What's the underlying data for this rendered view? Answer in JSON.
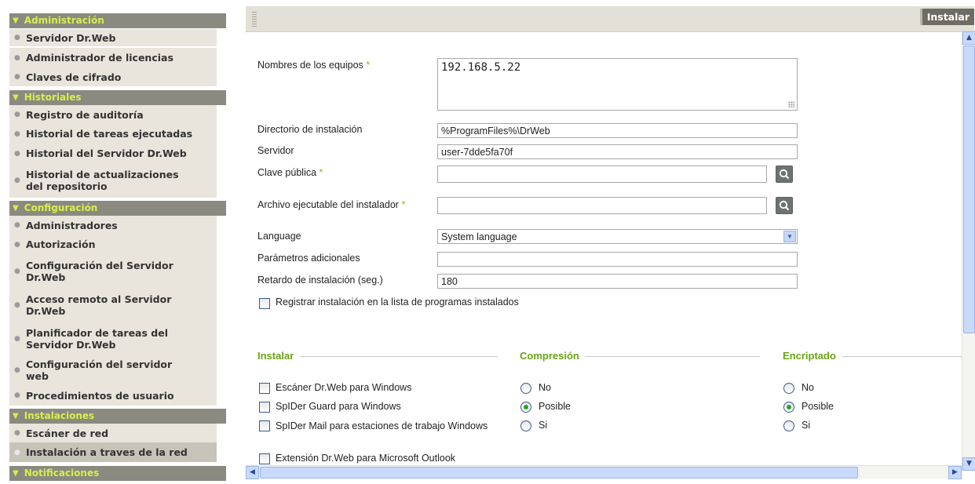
{
  "sidebar": {
    "sections": [
      {
        "title": "Administración",
        "items": [
          "Servidor Dr.Web",
          "Administrador de licencias",
          "Claves de cifrado"
        ]
      },
      {
        "title": "Historiales",
        "items": [
          "Registro de auditoría",
          "Historial de tareas ejecutadas",
          "Historial del Servidor Dr.Web",
          "Historial de actualizaciones del repositorio"
        ]
      },
      {
        "title": "Configuración",
        "items": [
          "Administradores",
          "Autorización",
          "Configuración del Servidor Dr.Web",
          "Acceso remoto al Servidor Dr.Web",
          "Planificador de tareas del Servidor Dr.Web",
          "Configuración del servidor web",
          "Procedimientos de usuario"
        ]
      },
      {
        "title": "Instalaciones",
        "items": [
          "Escáner de red",
          "Instalación a traves de la red"
        ]
      },
      {
        "title": "Notificaciones",
        "items": []
      }
    ],
    "active_item": "Instalación a traves de la red"
  },
  "toolbar": {
    "install_label": "Instalar"
  },
  "form": {
    "computer_names_label": "Nombres de los equipos",
    "computer_names_value": "192.168.5.22",
    "install_dir_label": "Directorio de instalación",
    "install_dir_value": "%ProgramFiles%\\DrWeb",
    "server_label": "Servidor",
    "server_value": "user-7dde5fa70f",
    "public_key_label": "Clave pública",
    "public_key_value": "",
    "installer_exe_label": "Archivo ejecutable del instalador",
    "installer_exe_value": "",
    "language_label": "Language",
    "language_value": "System language",
    "extra_params_label": "Parámetros adicionales",
    "extra_params_value": "",
    "install_delay_label": "Retardo de instalación (seg.)",
    "install_delay_value": "180",
    "register_label": "Registrar instalación en la lista de programas instalados",
    "required_mark": "*"
  },
  "groups": {
    "install": {
      "title": "Instalar",
      "items": [
        "Escáner Dr.Web para Windows",
        "SpIDer Guard para Windows",
        "SpIDer Mail para estaciones de trabajo Windows",
        "Extensión Dr.Web para Microsoft Outlook"
      ]
    },
    "compression": {
      "title": "Compresión",
      "options": [
        "No",
        "Posible",
        "Si"
      ],
      "selected": "Posible"
    },
    "encryption": {
      "title": "Encriptado",
      "options": [
        "No",
        "Posible",
        "Si"
      ],
      "selected": "Posible"
    }
  },
  "colors": {
    "section_bg": "#8a8a80",
    "section_text": "#d8f04a",
    "group_title": "#6aa315",
    "required": "#7dbb1e"
  },
  "icons": {
    "search": "magnifier-icon",
    "dropdown": "chevron-down-icon"
  }
}
